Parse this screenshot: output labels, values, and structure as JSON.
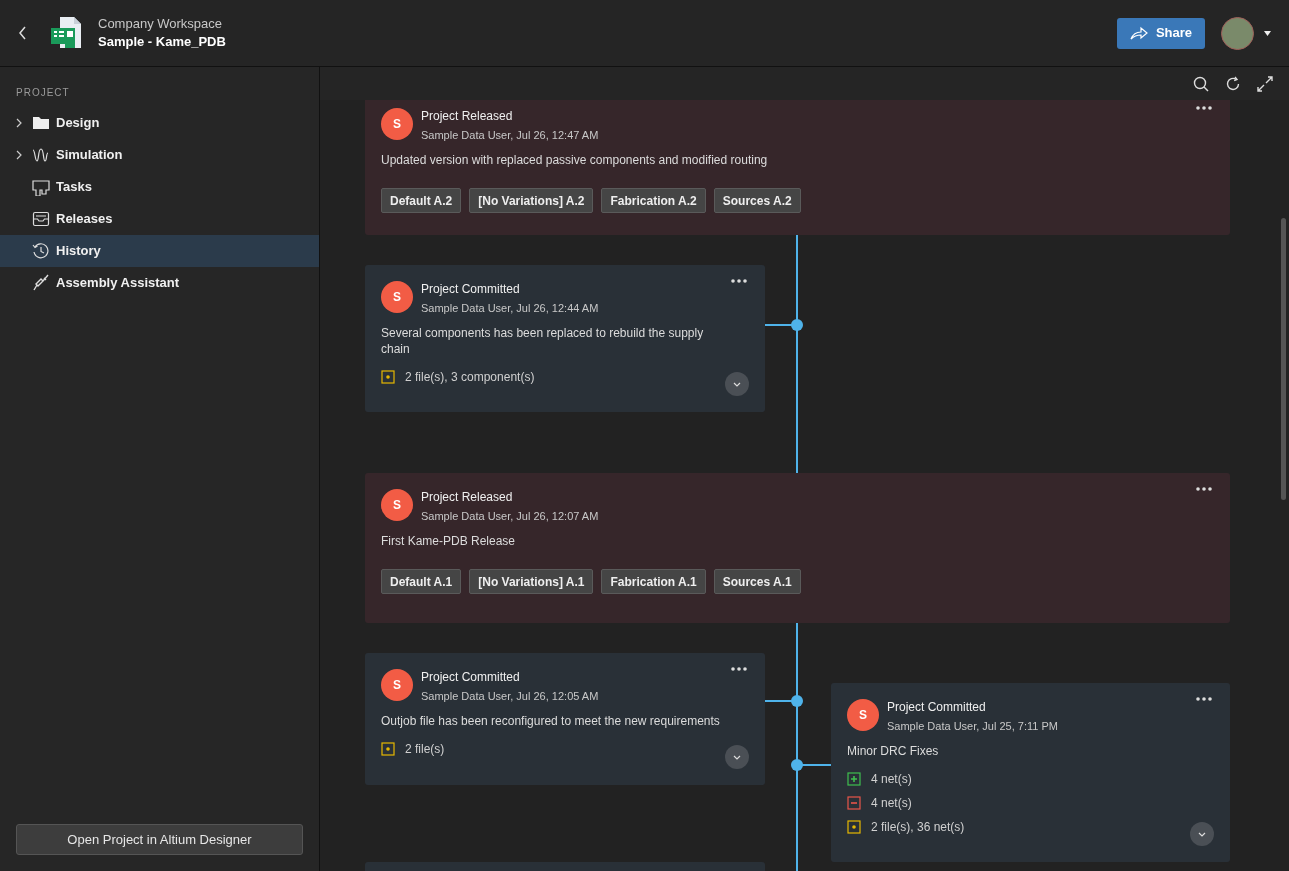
{
  "header": {
    "workspace": "Company Workspace",
    "project": "Sample - Kame_PDB",
    "share_button": "Share"
  },
  "sidebar": {
    "section": "PROJECT",
    "items": [
      {
        "label": "Design",
        "expandable": true,
        "selected": false
      },
      {
        "label": "Simulation",
        "expandable": true,
        "selected": false
      },
      {
        "label": "Tasks",
        "expandable": false,
        "selected": false
      },
      {
        "label": "Releases",
        "expandable": false,
        "selected": false
      },
      {
        "label": "History",
        "expandable": false,
        "selected": true
      },
      {
        "label": "Assembly Assistant",
        "expandable": false,
        "selected": false
      }
    ],
    "open_button": "Open Project in Altium Designer"
  },
  "timeline": [
    {
      "kind": "release",
      "avatar": "S",
      "title": "Project Released",
      "meta": "Sample Data User, Jul 26, 12:47 AM",
      "description": "Updated version with replaced passive components and modified routing",
      "tags": [
        "Default A.2",
        "[No Variations] A.2",
        "Fabrication A.2",
        "Sources A.2"
      ]
    },
    {
      "kind": "commit",
      "avatar": "S",
      "title": "Project Committed",
      "meta": "Sample Data User, Jul 26, 12:44 AM",
      "description": "Several components has been replaced to rebuild the supply chain",
      "changes": [
        {
          "kind": "modified",
          "text": "2 file(s), 3 component(s)"
        }
      ]
    },
    {
      "kind": "release",
      "avatar": "S",
      "title": "Project Released",
      "meta": "Sample Data User, Jul 26, 12:07 AM",
      "description": "First Kame-PDB Release",
      "tags": [
        "Default A.1",
        "[No Variations] A.1",
        "Fabrication A.1",
        "Sources A.1"
      ]
    },
    {
      "kind": "commit",
      "avatar": "S",
      "title": "Project Committed",
      "meta": "Sample Data User, Jul 26, 12:05 AM",
      "description": "Outjob file has been reconfigured to meet the new requirements",
      "changes": [
        {
          "kind": "modified",
          "text": "2 file(s)"
        }
      ]
    },
    {
      "kind": "commit",
      "avatar": "S",
      "title": "Project Committed",
      "meta": "Sample Data User, Jul 25, 7:11 PM",
      "description": "Minor DRC Fixes",
      "changes": [
        {
          "kind": "added",
          "text": "4 net(s)"
        },
        {
          "kind": "removed",
          "text": "4 net(s)"
        },
        {
          "kind": "modified",
          "text": "2 file(s), 36 net(s)"
        }
      ]
    }
  ]
}
